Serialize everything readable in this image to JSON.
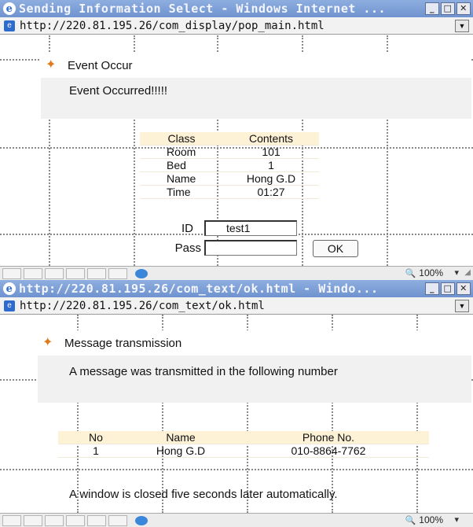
{
  "window1": {
    "title": "Sending Information Select - Windows Internet ...",
    "url": "http://220.81.195.26/com_display/pop_main.html",
    "message_box": {
      "header": "Event Occur",
      "text": "Event Occurred!!!!!"
    },
    "table": {
      "headers": [
        "Class",
        "Contents"
      ],
      "rows": [
        [
          "Room",
          "101"
        ],
        [
          "Bed",
          "1"
        ],
        [
          "Name",
          "Hong G.D"
        ],
        [
          "Time",
          "01:27"
        ]
      ]
    },
    "login": {
      "id_label": "ID",
      "id_value": "test1",
      "pass_label": "Pass",
      "pass_value": "",
      "ok_label": "OK"
    },
    "zoom": "100%"
  },
  "window2": {
    "title": "http://220.81.195.26/com_text/ok.html - Windo...",
    "url": "http://220.81.195.26/com_text/ok.html",
    "message_box": {
      "header": "Message transmission",
      "text": "A message was transmitted in the following number"
    },
    "table": {
      "headers": [
        "No",
        "Name",
        "Phone No."
      ],
      "rows": [
        [
          "1",
          "Hong G.D",
          "010-8864-7762"
        ]
      ]
    },
    "footer_text": "A window is closed five seconds later automatically.",
    "zoom": "100%"
  },
  "icons": {
    "title_logo": "ie-logo-icon",
    "page": "page-icon",
    "message": "bird-icon",
    "status_globe": "globe-icon",
    "zoom": "zoom-icon"
  }
}
